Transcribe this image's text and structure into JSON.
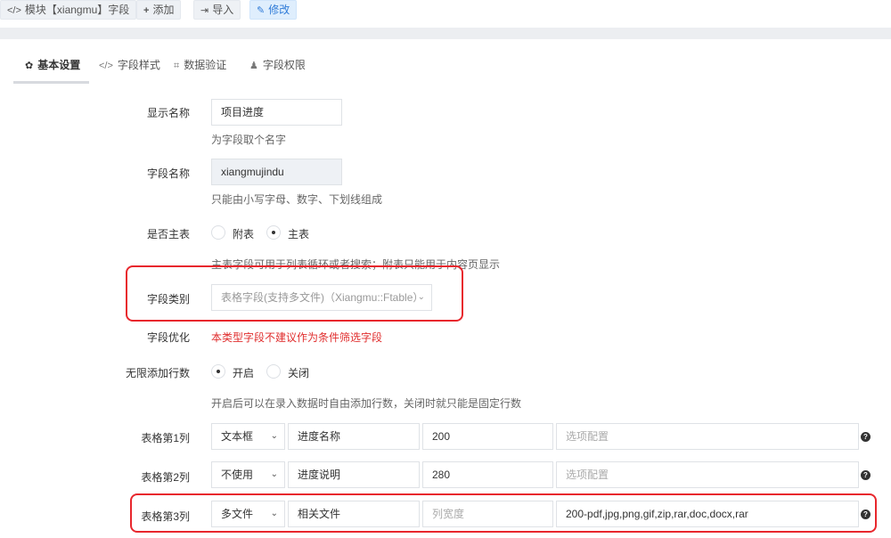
{
  "toolbar": {
    "title_label": "模块【xiangmu】字段",
    "add_label": "添加",
    "import_label": "导入",
    "edit_label": "修改"
  },
  "tabs": [
    {
      "label": "基本设置",
      "icon": "gear-icon",
      "active": true
    },
    {
      "label": "字段样式",
      "icon": "code-icon"
    },
    {
      "label": "数据验证",
      "icon": "crop-icon"
    },
    {
      "label": "字段权限",
      "icon": "user-icon"
    }
  ],
  "form": {
    "display_name": {
      "label": "显示名称",
      "value": "项目进度",
      "help": "为字段取个名字"
    },
    "field_name": {
      "label": "字段名称",
      "value": "xiangmujindu",
      "help": "只能由小写字母、数字、下划线组成"
    },
    "is_main": {
      "label": "是否主表",
      "options": [
        "附表",
        "主表"
      ],
      "selected": "主表",
      "help": "主表字段可用于列表循环或者搜索；附表只能用于内容页显示"
    },
    "field_type": {
      "label": "字段类别",
      "value": "表格字段(支持多文件)（Xiangmu::Ftable）"
    },
    "field_optimize": {
      "label": "字段优化",
      "warning": "本类型字段不建议作为条件筛选字段"
    },
    "unlimited_rows": {
      "label": "无限添加行数",
      "options": [
        "开启",
        "关闭"
      ],
      "selected": "开启",
      "help": "开启后可以在录入数据时自由添加行数，关闭时就只能是固定行数"
    },
    "columns": [
      {
        "label": "表格第1列",
        "type": "文本框",
        "name": "进度名称",
        "width": "200",
        "width_placeholder": "列宽度",
        "config": "",
        "config_placeholder": "选项配置"
      },
      {
        "label": "表格第2列",
        "type": "不使用",
        "name": "进度说明",
        "width": "280",
        "width_placeholder": "列宽度",
        "config": "",
        "config_placeholder": "选项配置"
      },
      {
        "label": "表格第3列",
        "type": "多文件",
        "name": "相关文件",
        "width": "",
        "width_placeholder": "列宽度",
        "config": "200-pdf,jpg,png,gif,zip,rar,doc,docx,rar",
        "config_placeholder": "选项配置"
      }
    ]
  },
  "colors": {
    "accent": "#2f7bd8",
    "warning": "#e02d2d",
    "highlight_box": "#e8272d"
  }
}
